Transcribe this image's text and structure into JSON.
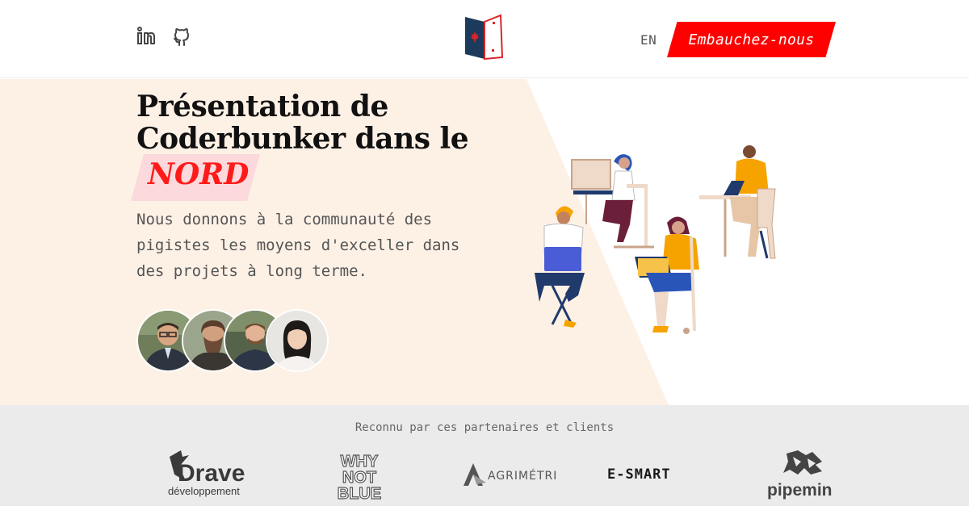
{
  "header": {
    "lang_toggle": "EN",
    "hire_button": "Embauchez-nous"
  },
  "hero": {
    "title": "Présentation de Coderbunker dans le",
    "region": "NORD",
    "description": "Nous donnons à la communauté des pigistes les moyens d'exceller dans des projets à long terme."
  },
  "partners": {
    "title": "Reconnu par ces partenaires et clients",
    "logos": [
      {
        "line1": "Drave",
        "line2": "développement"
      },
      {
        "line1": "WHY NOT BLUE"
      },
      {
        "line1": "AGRIMÉTRIE"
      },
      {
        "line1": "E-SMART"
      },
      {
        "line1": "pipemin"
      }
    ]
  },
  "colors": {
    "accent": "#ff0000",
    "hero_bg": "#fdf1e6",
    "partner_bg": "#ebebeb"
  }
}
